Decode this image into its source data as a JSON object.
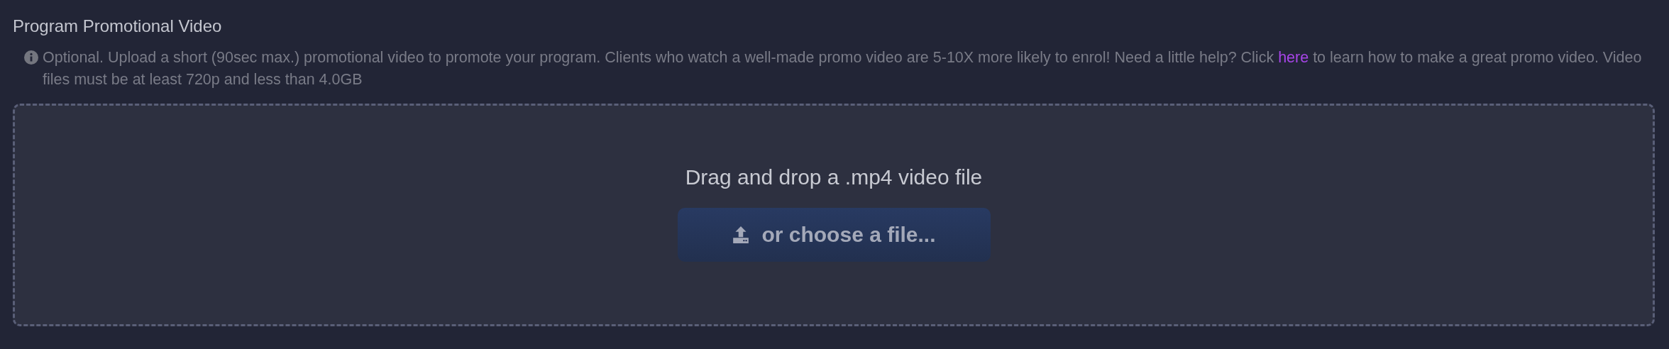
{
  "section": {
    "title": "Program Promotional Video",
    "help": {
      "before": "Optional. Upload a short (90sec max.) promotional video to promote your program. Clients who watch a well-made promo video are 5-10X more likely to enrol! Need a little help? Click",
      "link": "here",
      "after": "to learn how to make a great promo video. Video files must be at least 720p and less than 4.0GB"
    },
    "dropzone": {
      "prompt": "Drag and drop a .mp4 video file",
      "button": "or choose a file..."
    }
  }
}
